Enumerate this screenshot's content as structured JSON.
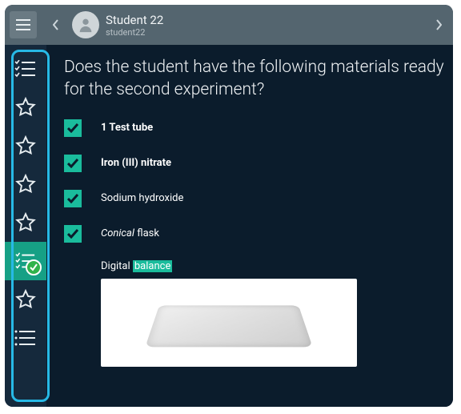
{
  "header": {
    "user_name": "Student 22",
    "user_id": "student22"
  },
  "question": "Does the student have the following materials ready for the second experiment?",
  "items": [
    {
      "label_bold": "1 Test tube",
      "label_rest": ""
    },
    {
      "label_bold": "Iron (III) nitrate",
      "label_rest": ""
    },
    {
      "label_bold": "",
      "label_rest": "Sodium hydroxide"
    },
    {
      "label_bold": "",
      "label_rest": "",
      "italic": "Conical",
      "after_italic": " flask"
    }
  ],
  "digital": {
    "prefix": "Digital ",
    "highlight": "balance"
  }
}
